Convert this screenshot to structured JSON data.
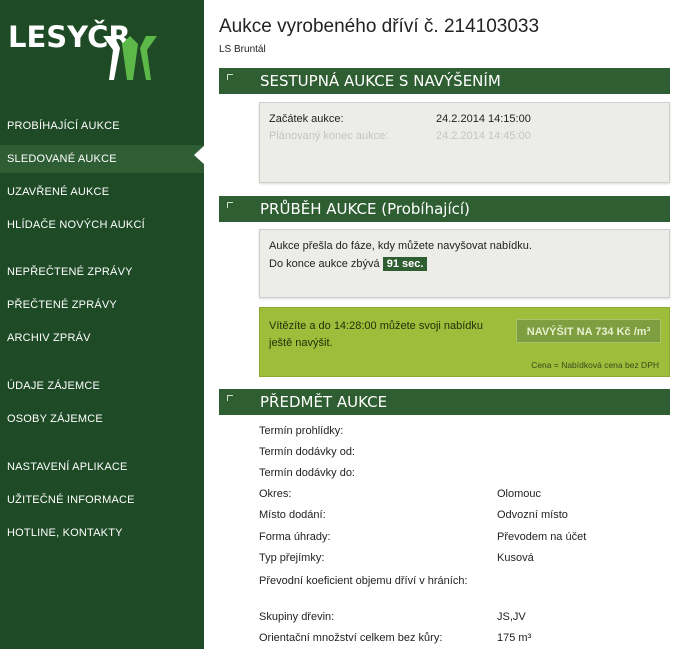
{
  "brand": {
    "name": "LESYČR"
  },
  "nav": {
    "items": [
      {
        "label": "PROBÍHAJÍCÍ AUKCE"
      },
      {
        "label": "SLEDOVANÉ AUKCE"
      },
      {
        "label": "UZAVŘENÉ AUKCE"
      },
      {
        "label": "HLÍDAČE NOVÝCH AUKCÍ"
      },
      {
        "label": "NEPŘEČTENÉ ZPRÁVY"
      },
      {
        "label": "PŘEČTENÉ ZPRÁVY"
      },
      {
        "label": "ARCHIV ZPRÁV"
      },
      {
        "label": "ÚDAJE ZÁJEMCE"
      },
      {
        "label": "OSOBY ZÁJEMCE"
      },
      {
        "label": "NASTAVENÍ APLIKACE"
      },
      {
        "label": "UŽITEČNÉ INFORMACE"
      },
      {
        "label": "HOTLINE, KONTAKTY"
      }
    ],
    "active": "SLEDOVANÉ AUKCE"
  },
  "header": {
    "title": "Aukce vyrobeného dříví č. 214103033",
    "subtitle": "LS Bruntál"
  },
  "section1": {
    "title": "SESTUPNÁ AUKCE S NAVÝŠENÍM",
    "start_label": "Začátek aukce:",
    "start_value": "24.2.2014 14:15:00",
    "end_label": "Plánovaný konec aukce:",
    "end_value": "24.2.2014 14:45:00"
  },
  "section2": {
    "title": "PRŮBĚH AUKCE (Probíhající)",
    "line1": "Aukce přešla do fáze, kdy můžete navyšovat nabídku.",
    "line2": "Do konce aukce zbývá",
    "remaining": "91 sec.",
    "winner_text": "Vítězíte a do 14:28:00 můžete svoji nabídku ještě navýšit.",
    "raise_button": "NAVÝŠIT NA 734 Kč /m³",
    "price_note": "Cena = Nabídková cena bez DPH"
  },
  "section3": {
    "title": "PŘEDMĚT AUKCE",
    "rows": [
      {
        "label": "Termín prohlídky:",
        "value": ""
      },
      {
        "label": "Termín dodávky od:",
        "value": ""
      },
      {
        "label": "Termín dodávky do:",
        "value": ""
      },
      {
        "label": "Okres:",
        "value": "Olomouc"
      },
      {
        "label": "Místo dodání:",
        "value": "Odvozní místo"
      },
      {
        "label": "Forma úhrady:",
        "value": "Převodem na účet"
      },
      {
        "label": "Typ přejímky:",
        "value": "Kusová"
      },
      {
        "label": "Převodní koeficient objemu dříví v hráních:",
        "value": ""
      },
      {
        "label": "Skupiny dřevin:",
        "value": "JS,JV"
      },
      {
        "label": "Orientační množství celkem bez kůry:",
        "value": "175 m³"
      }
    ]
  },
  "colors": {
    "sidebar": "#1e4a26",
    "section_header": "#2e5e31",
    "accent_green": "#9ebd3a",
    "logo_green": "#5db84a"
  }
}
